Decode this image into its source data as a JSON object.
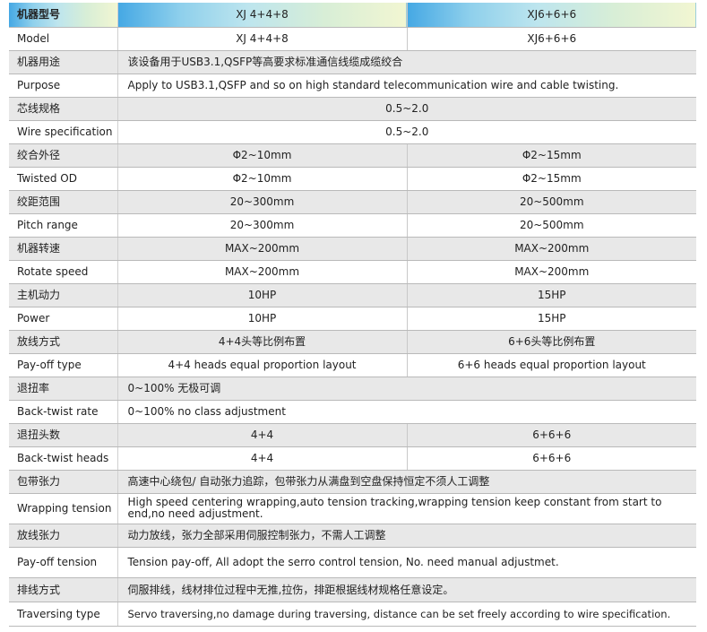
{
  "header": {
    "label": "机器型号",
    "model_a": "XJ 4+4+8",
    "model_b": "XJ6+6+6"
  },
  "rows": [
    {
      "label": "Model",
      "a": "XJ 4+4+8",
      "b": "XJ6+6+6"
    },
    {
      "label": "机器用途",
      "value": "该设备用于USB3.1,QSFP等高要求标准通信线缆成缆绞合"
    },
    {
      "label": "Purpose",
      "value": "Apply to USB3.1,QSFP and so on high standard telecommunication wire and cable twisting."
    },
    {
      "label": "芯线规格",
      "value": "0.5~2.0"
    },
    {
      "label": "Wire specification",
      "value": "0.5~2.0"
    },
    {
      "label": "绞合外径",
      "a": "Φ2~10mm",
      "b": "Φ2~15mm"
    },
    {
      "label": "Twisted OD",
      "a": "Φ2~10mm",
      "b": "Φ2~15mm"
    },
    {
      "label": "绞距范围",
      "a": "20~300mm",
      "b": "20~500mm"
    },
    {
      "label": "Pitch range",
      "a": "20~300mm",
      "b": "20~500mm"
    },
    {
      "label": "机器转速",
      "a": "MAX~200mm",
      "b": "MAX~200mm"
    },
    {
      "label": "Rotate speed",
      "a": "MAX~200mm",
      "b": "MAX~200mm"
    },
    {
      "label": "主机动力",
      "a": "10HP",
      "b": "15HP"
    },
    {
      "label": "Power",
      "a": "10HP",
      "b": "15HP"
    },
    {
      "label": "放线方式",
      "a": "4+4头等比例布置",
      "b": "6+6头等比例布置"
    },
    {
      "label": "Pay-off type",
      "a": "4+4 heads equal proportion layout",
      "b": "6+6 heads equal proportion layout"
    },
    {
      "label": "退扭率",
      "value": "0~100% 无极可调"
    },
    {
      "label": "Back-twist rate",
      "value": "0~100% no class adjustment"
    },
    {
      "label": "退扭头数",
      "a": "4+4",
      "b": "6+6+6"
    },
    {
      "label": "Back-twist heads",
      "a": "4+4",
      "b": "6+6+6"
    },
    {
      "label": "包带张力",
      "value": "高速中心绕包/ 自动张力追踪，包带张力从满盘到空盘保持恒定不须人工调整"
    },
    {
      "label": "Wrapping tension",
      "value": "High speed centering wrapping,auto tension tracking,wrapping tension keep constant from start to end,no need adjustment."
    },
    {
      "label": "放线张力",
      "value": "动力放线，张力全部采用伺服控制张力，不需人工调整"
    },
    {
      "label": "Pay-off tension",
      "value": "Tension pay-off, All adopt the serro control tension, No. need manual adjustmet."
    },
    {
      "label": "排线方式",
      "value": "伺服排线，线材排位过程中无推,拉伤，排距根据线材规格任意设定。"
    },
    {
      "label": "Traversing type",
      "value": "Servo traversing,no damage during traversing, distance can be set freely according to wire specification."
    }
  ]
}
